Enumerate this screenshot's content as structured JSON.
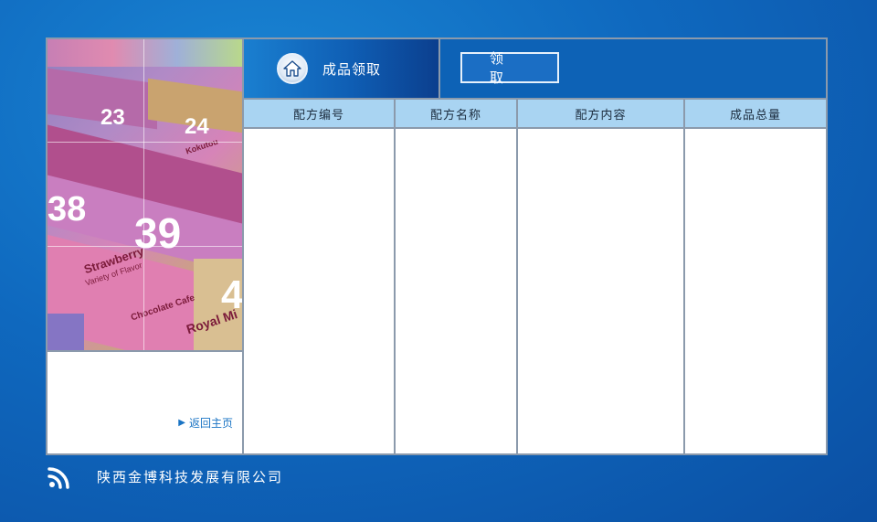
{
  "header": {
    "title": "成品领取",
    "claim_button": "领 取"
  },
  "table": {
    "columns": [
      "配方编号",
      "配方名称",
      "配方内容",
      "成品总量"
    ]
  },
  "sidebar": {
    "back_link": "返回主页",
    "photo": {
      "numbers": [
        "23",
        "24",
        "38",
        "39",
        "4"
      ],
      "labels": [
        "Strawberry",
        "Variety of Flavor",
        "Chocolate Cafe",
        "Royal Mi",
        "Kokutou"
      ]
    }
  },
  "footer": {
    "company": "陕西金博科技发展有限公司"
  },
  "colors": {
    "background": "#0f69bf",
    "header": "#0d62b6",
    "table_header": "#a9d4f2",
    "border": "#8b9aac",
    "link": "#1a74c4"
  }
}
